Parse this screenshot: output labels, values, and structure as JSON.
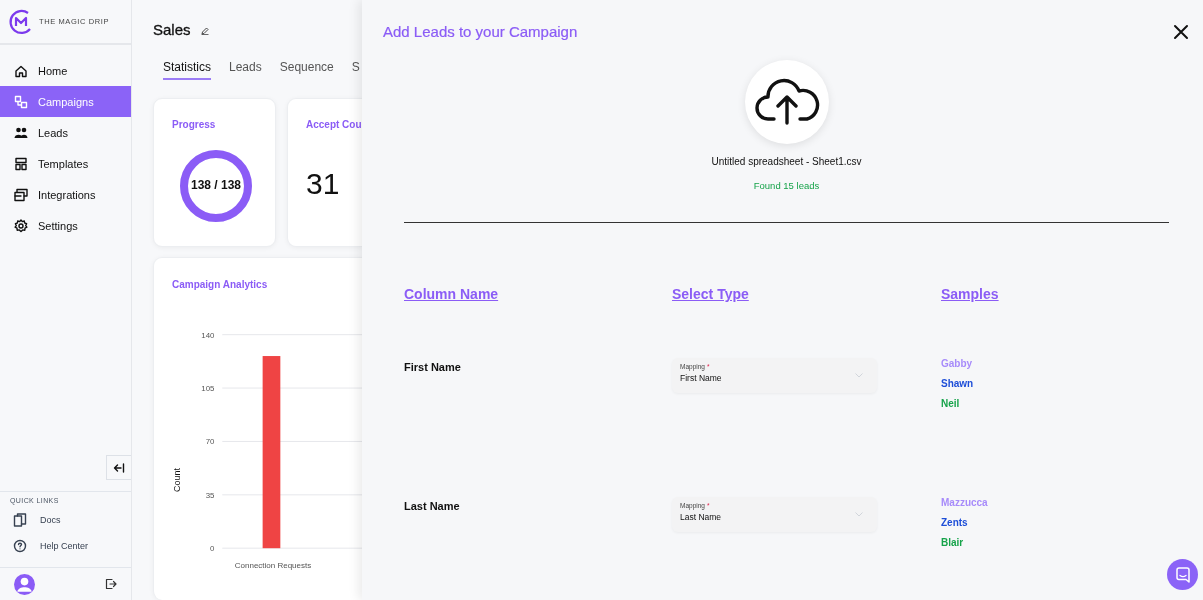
{
  "brand": {
    "name": "THE MAGIC DRIP"
  },
  "nav": [
    {
      "label": "Home",
      "kind": "home",
      "selected": false
    },
    {
      "label": "Campaigns",
      "kind": "campaigns",
      "selected": true
    },
    {
      "label": "Leads",
      "kind": "people",
      "selected": false
    },
    {
      "label": "Templates",
      "kind": "templates",
      "selected": false
    },
    {
      "label": "Integrations",
      "kind": "integrations",
      "selected": false
    },
    {
      "label": "Settings",
      "kind": "settings",
      "selected": false
    }
  ],
  "quick_links": {
    "title": "QUICK LINKS",
    "items": [
      {
        "label": "Docs",
        "kind": "docs"
      },
      {
        "label": "Help Center",
        "kind": "help"
      }
    ]
  },
  "page": {
    "title": "Sales",
    "tabs": [
      {
        "label": "Statistics",
        "selected": true
      },
      {
        "label": "Leads",
        "selected": false
      },
      {
        "label": "Sequence",
        "selected": false
      },
      {
        "label": "S",
        "selected": false
      }
    ],
    "progress": {
      "title": "Progress",
      "reading": "138 / 138",
      "level": 1
    },
    "accept": {
      "title": "Accept Cou",
      "value": "31"
    },
    "analytics": {
      "title": "Campaign Analytics",
      "chart_data": {
        "type": "bar",
        "ylabel": "Count",
        "categories": [
          "Connection Requests"
        ],
        "series": [
          {
            "color": "#ef4444",
            "values": [
              126
            ]
          }
        ],
        "ylim": [
          0,
          140
        ],
        "yticks": [
          0,
          35,
          70,
          105,
          140
        ],
        "grid": true
      }
    }
  },
  "drawer": {
    "title": "Add Leads to your Campaign",
    "file_name": "Untitled spreadsheet - Sheet1.csv",
    "found": "Found 15 leads",
    "columns": [
      "Column Name",
      "Select Type",
      "Samples"
    ],
    "rows": [
      {
        "name": "First Name",
        "field_label": "Mapping",
        "required_mark": "*",
        "value": "First Name",
        "samples": [
          {
            "text": "Gabby",
            "color": "#a78bfa"
          },
          {
            "text": "Shawn",
            "color": "#1d4ed8"
          },
          {
            "text": "Neil",
            "color": "#16a34a"
          }
        ]
      },
      {
        "name": "Last Name",
        "field_label": "Mapping",
        "required_mark": "*",
        "value": "Last Name",
        "samples": [
          {
            "text": "Mazzucca",
            "color": "#a78bfa"
          },
          {
            "text": "Zents",
            "color": "#1d4ed8"
          },
          {
            "text": "Blair",
            "color": "#16a34a"
          }
        ]
      }
    ]
  }
}
